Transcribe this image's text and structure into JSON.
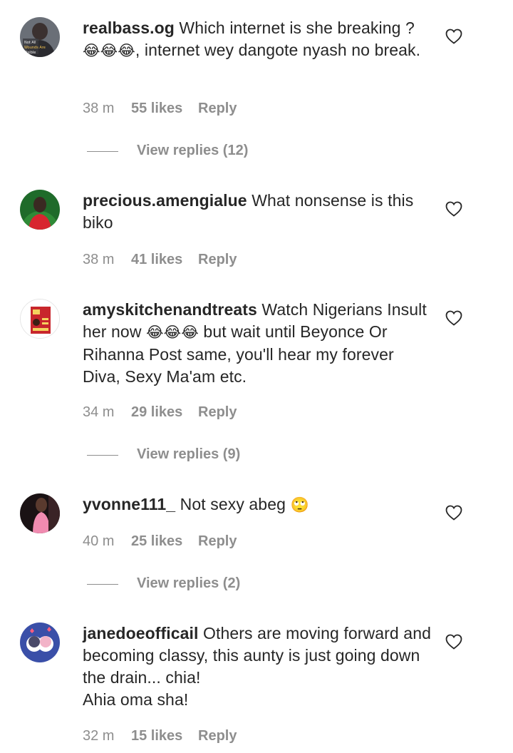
{
  "comments": [
    {
      "username": "realbass.og",
      "text_parts": [
        " Which internet is she breaking ?",
        "😂😂😂",
        ", internet wey dangote nyash no break."
      ],
      "time": "38 m",
      "likes": "55 likes",
      "reply": "Reply",
      "view_replies": "View replies (12)",
      "avatar_icon": "profile-photo"
    },
    {
      "username": "precious.amengialue",
      "text_parts": [
        " What nonsense is this biko"
      ],
      "time": "38 m",
      "likes": "41 likes",
      "reply": "Reply",
      "avatar_icon": "profile-photo"
    },
    {
      "username": "amyskitchenandtreats",
      "text_parts": [
        " Watch Nigerians Insult her now ",
        "😂😂😂",
        " but wait until Beyonce Or Rihanna Post same, you'll hear my forever Diva, Sexy Ma'am etc."
      ],
      "time": "34 m",
      "likes": "29 likes",
      "reply": "Reply",
      "view_replies": "View replies (9)",
      "avatar_icon": "profile-photo"
    },
    {
      "username": "yvonne111_",
      "text_parts": [
        " Not sexy abeg ",
        "🙄"
      ],
      "time": "40 m",
      "likes": "25 likes",
      "reply": "Reply",
      "view_replies": "View replies (2)",
      "avatar_icon": "profile-photo"
    },
    {
      "username": "janedoeofficail",
      "text_parts": [
        " Others are moving forward and becoming classy, this aunty is just going down the drain... chia!",
        "Ahia oma sha!"
      ],
      "time": "32 m",
      "likes": "15 likes",
      "reply": "Reply",
      "avatar_icon": "profile-photo"
    }
  ],
  "avatar_overlay_text": [
    "Not All",
    "Wounds Are",
    "Visible"
  ],
  "heart_icon": "heart-outline-icon",
  "colors": {
    "text": "#262626",
    "secondary": "#8e8e8e",
    "background": "#ffffff"
  }
}
